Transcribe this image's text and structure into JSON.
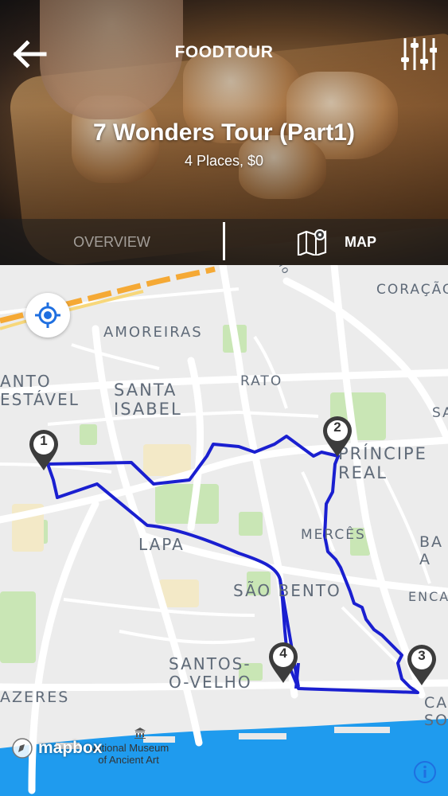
{
  "header": {
    "brand": "FOODTOUR",
    "tour_title": "7 Wonders Tour (Part1)",
    "tour_subtitle": "4 Places, $0"
  },
  "tabs": [
    {
      "label": "OVERVIEW",
      "active": false
    },
    {
      "label": "MAP",
      "active": true
    }
  ],
  "map": {
    "neighborhoods": {
      "coracao_de_jesus": "CORAÇÃO\nDE JESUS",
      "amoreiras": "AMOREIRAS",
      "santo_estavel": "ANTO\nESTÁVEL",
      "santa_isabel": "SANTA\nISABEL",
      "rato": "RATO",
      "principe_real": "PRÍNCIPE\nREAL",
      "mercês": "MERCÊS",
      "lapa": "LAPA",
      "sao_bento": "SÃO BENTO",
      "santos_o_velho": "SANTOS-\nO-VELHO",
      "prazeres": "AZERES",
      "ba_a": "BA\nA",
      "enca": "ENCA",
      "ca_so": "CA\nSO",
      "sa": "SA",
      "road_fragment": "ho"
    },
    "poi": "National Museum\nof Ancient Art",
    "stops": [
      "1",
      "2",
      "3",
      "4"
    ],
    "route_color": "#1a1fd0",
    "attribution": "mapbox"
  },
  "icons": {
    "back": "back-arrow-icon",
    "filter": "sliders-icon",
    "map_tab": "map-icon",
    "locate": "crosshair-icon",
    "info": "info-icon",
    "museum": "museum-icon"
  }
}
